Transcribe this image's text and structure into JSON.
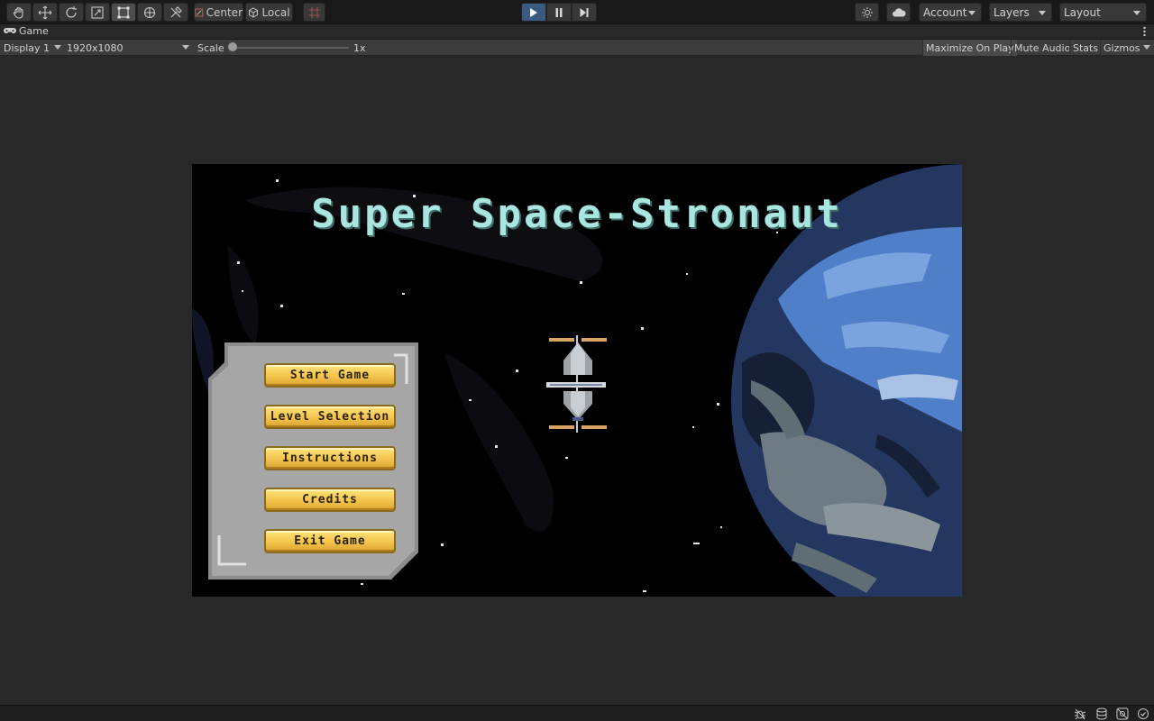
{
  "toolbar": {
    "pivot_center_label": "Center",
    "pivot_local_label": "Local",
    "account_label": "Account",
    "layers_label": "Layers",
    "layout_label": "Layout"
  },
  "tab": {
    "title": "Game"
  },
  "game_controls": {
    "display": "Display 1",
    "resolution": "1920x1080",
    "scale_label": "Scale",
    "scale_value": "1x",
    "maximize_on_play": "Maximize On Play",
    "mute_audio": "Mute Audio",
    "stats": "Stats",
    "gizmos": "Gizmos"
  },
  "game": {
    "title": "Super Space-Stronaut",
    "menu": [
      {
        "label": "Start Game"
      },
      {
        "label": "Level Selection"
      },
      {
        "label": "Instructions"
      },
      {
        "label": "Credits"
      },
      {
        "label": "Exit Game"
      }
    ]
  },
  "colors": {
    "title_text": "#a9e6e0",
    "button_gold": "#f3c44c",
    "planet_blue": "#4f7fc9",
    "panel_gray": "#a6a6a6",
    "play_active": "#3a5a82"
  }
}
